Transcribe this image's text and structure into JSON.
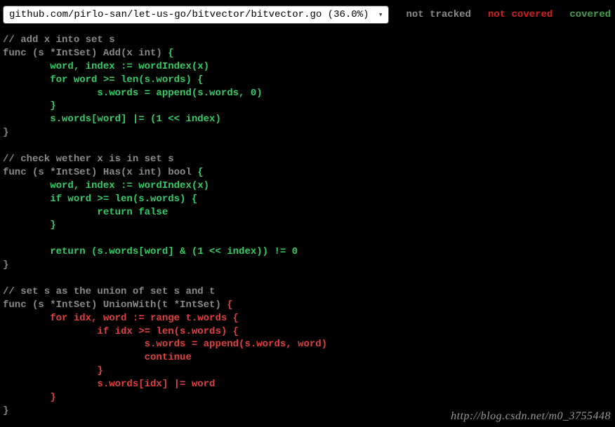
{
  "topbar": {
    "file_select": "github.com/pirlo-san/let-us-go/bitvector/bitvector.go (36.0%)",
    "legend": {
      "not_tracked": "not tracked",
      "not_covered": "not covered",
      "covered": "covered"
    }
  },
  "code": {
    "lines": [
      {
        "cls": "tok-comment",
        "text": "// add x into set s"
      },
      {
        "segments": [
          {
            "cls": "tok-nt",
            "text": "func (s *IntSet) Add(x int) "
          },
          {
            "cls": "tok-cov",
            "text": "{"
          }
        ]
      },
      {
        "cls": "tok-cov",
        "text": "        word, index := wordIndex(x)"
      },
      {
        "cls": "tok-cov",
        "text": "        for word >= len(s.words) {"
      },
      {
        "cls": "tok-cov",
        "text": "                s.words = append(s.words, 0)"
      },
      {
        "cls": "tok-cov",
        "text": "        }"
      },
      {
        "cls": "tok-cov",
        "text": "        s.words[word] |= (1 << index)"
      },
      {
        "cls": "tok-nt",
        "text": "}"
      },
      {
        "cls": "tok-nt",
        "text": ""
      },
      {
        "cls": "tok-comment",
        "text": "// check wether x is in set s"
      },
      {
        "segments": [
          {
            "cls": "tok-nt",
            "text": "func (s *IntSet) Has(x int) bool "
          },
          {
            "cls": "tok-cov",
            "text": "{"
          }
        ]
      },
      {
        "cls": "tok-cov",
        "text": "        word, index := wordIndex(x)"
      },
      {
        "cls": "tok-cov",
        "text": "        if word >= len(s.words) {"
      },
      {
        "cls": "tok-cov",
        "text": "                return false"
      },
      {
        "cls": "tok-cov",
        "text": "        }"
      },
      {
        "cls": "tok-nt",
        "text": ""
      },
      {
        "cls": "tok-cov",
        "text": "        return (s.words[word] & (1 << index)) != 0"
      },
      {
        "cls": "tok-nt",
        "text": "}"
      },
      {
        "cls": "tok-nt",
        "text": ""
      },
      {
        "cls": "tok-comment",
        "text": "// set s as the union of set s and t"
      },
      {
        "segments": [
          {
            "cls": "tok-nt",
            "text": "func (s *IntSet) UnionWith(t *IntSet) "
          },
          {
            "cls": "tok-ncov",
            "text": "{"
          }
        ]
      },
      {
        "cls": "tok-ncov",
        "text": "        for idx, word := range t.words {"
      },
      {
        "cls": "tok-ncov",
        "text": "                if idx >= len(s.words) {"
      },
      {
        "cls": "tok-ncov",
        "text": "                        s.words = append(s.words, word)"
      },
      {
        "cls": "tok-ncov",
        "text": "                        continue"
      },
      {
        "cls": "tok-ncov",
        "text": "                }"
      },
      {
        "cls": "tok-ncov",
        "text": "                s.words[idx] |= word"
      },
      {
        "cls": "tok-ncov",
        "text": "        }"
      },
      {
        "cls": "tok-nt",
        "text": "}"
      }
    ]
  },
  "watermark": "http://blog.csdn.net/m0_3755448"
}
